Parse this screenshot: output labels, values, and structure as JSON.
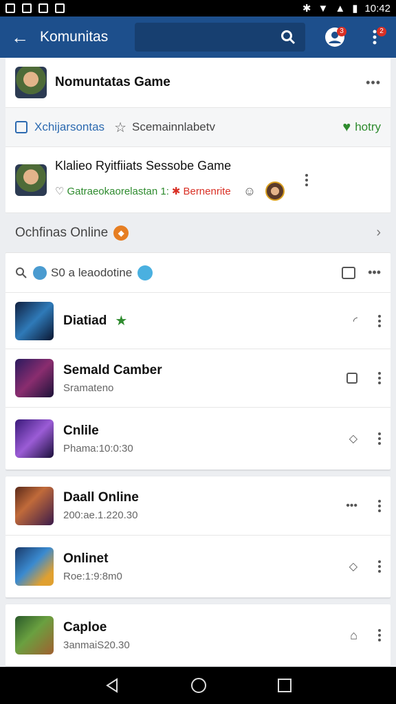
{
  "status": {
    "time": "10:42"
  },
  "appbar": {
    "title": "Komunitas",
    "badge1": "3",
    "badge2": "2"
  },
  "header_card": {
    "title": "Nomuntatas Game",
    "more": "•••"
  },
  "filter": {
    "left": "Xchijarsontas",
    "middle": "Scemainnlabetv",
    "right": "hotry"
  },
  "featured": {
    "title": "Klalieo Ryitfiiats Sessobe Game",
    "line_green": "Gatraeokaorelastan 1:",
    "line_red": "Bernenrite"
  },
  "section": {
    "title": "Ochfinas Online",
    "search_text": "S0 a leaodotine",
    "more": "•••"
  },
  "items": [
    {
      "title": "Diatiad",
      "sub": ""
    },
    {
      "title": "Semald Camber",
      "sub": "Sramateno"
    },
    {
      "title": "Cnlile",
      "sub": "Phama:10:0:30"
    },
    {
      "title": "Daall Online",
      "sub": "200:ae.1.220.30",
      "more": "•••"
    },
    {
      "title": "Onlinet",
      "sub": "Roe:1:9:8m0"
    },
    {
      "title": "Caploe",
      "sub": "3anmaiS20.30"
    }
  ],
  "colors": {
    "appbar": "#1d4f8c",
    "green": "#2e8b2e",
    "red": "#d93025",
    "link": "#2c6ab0"
  }
}
